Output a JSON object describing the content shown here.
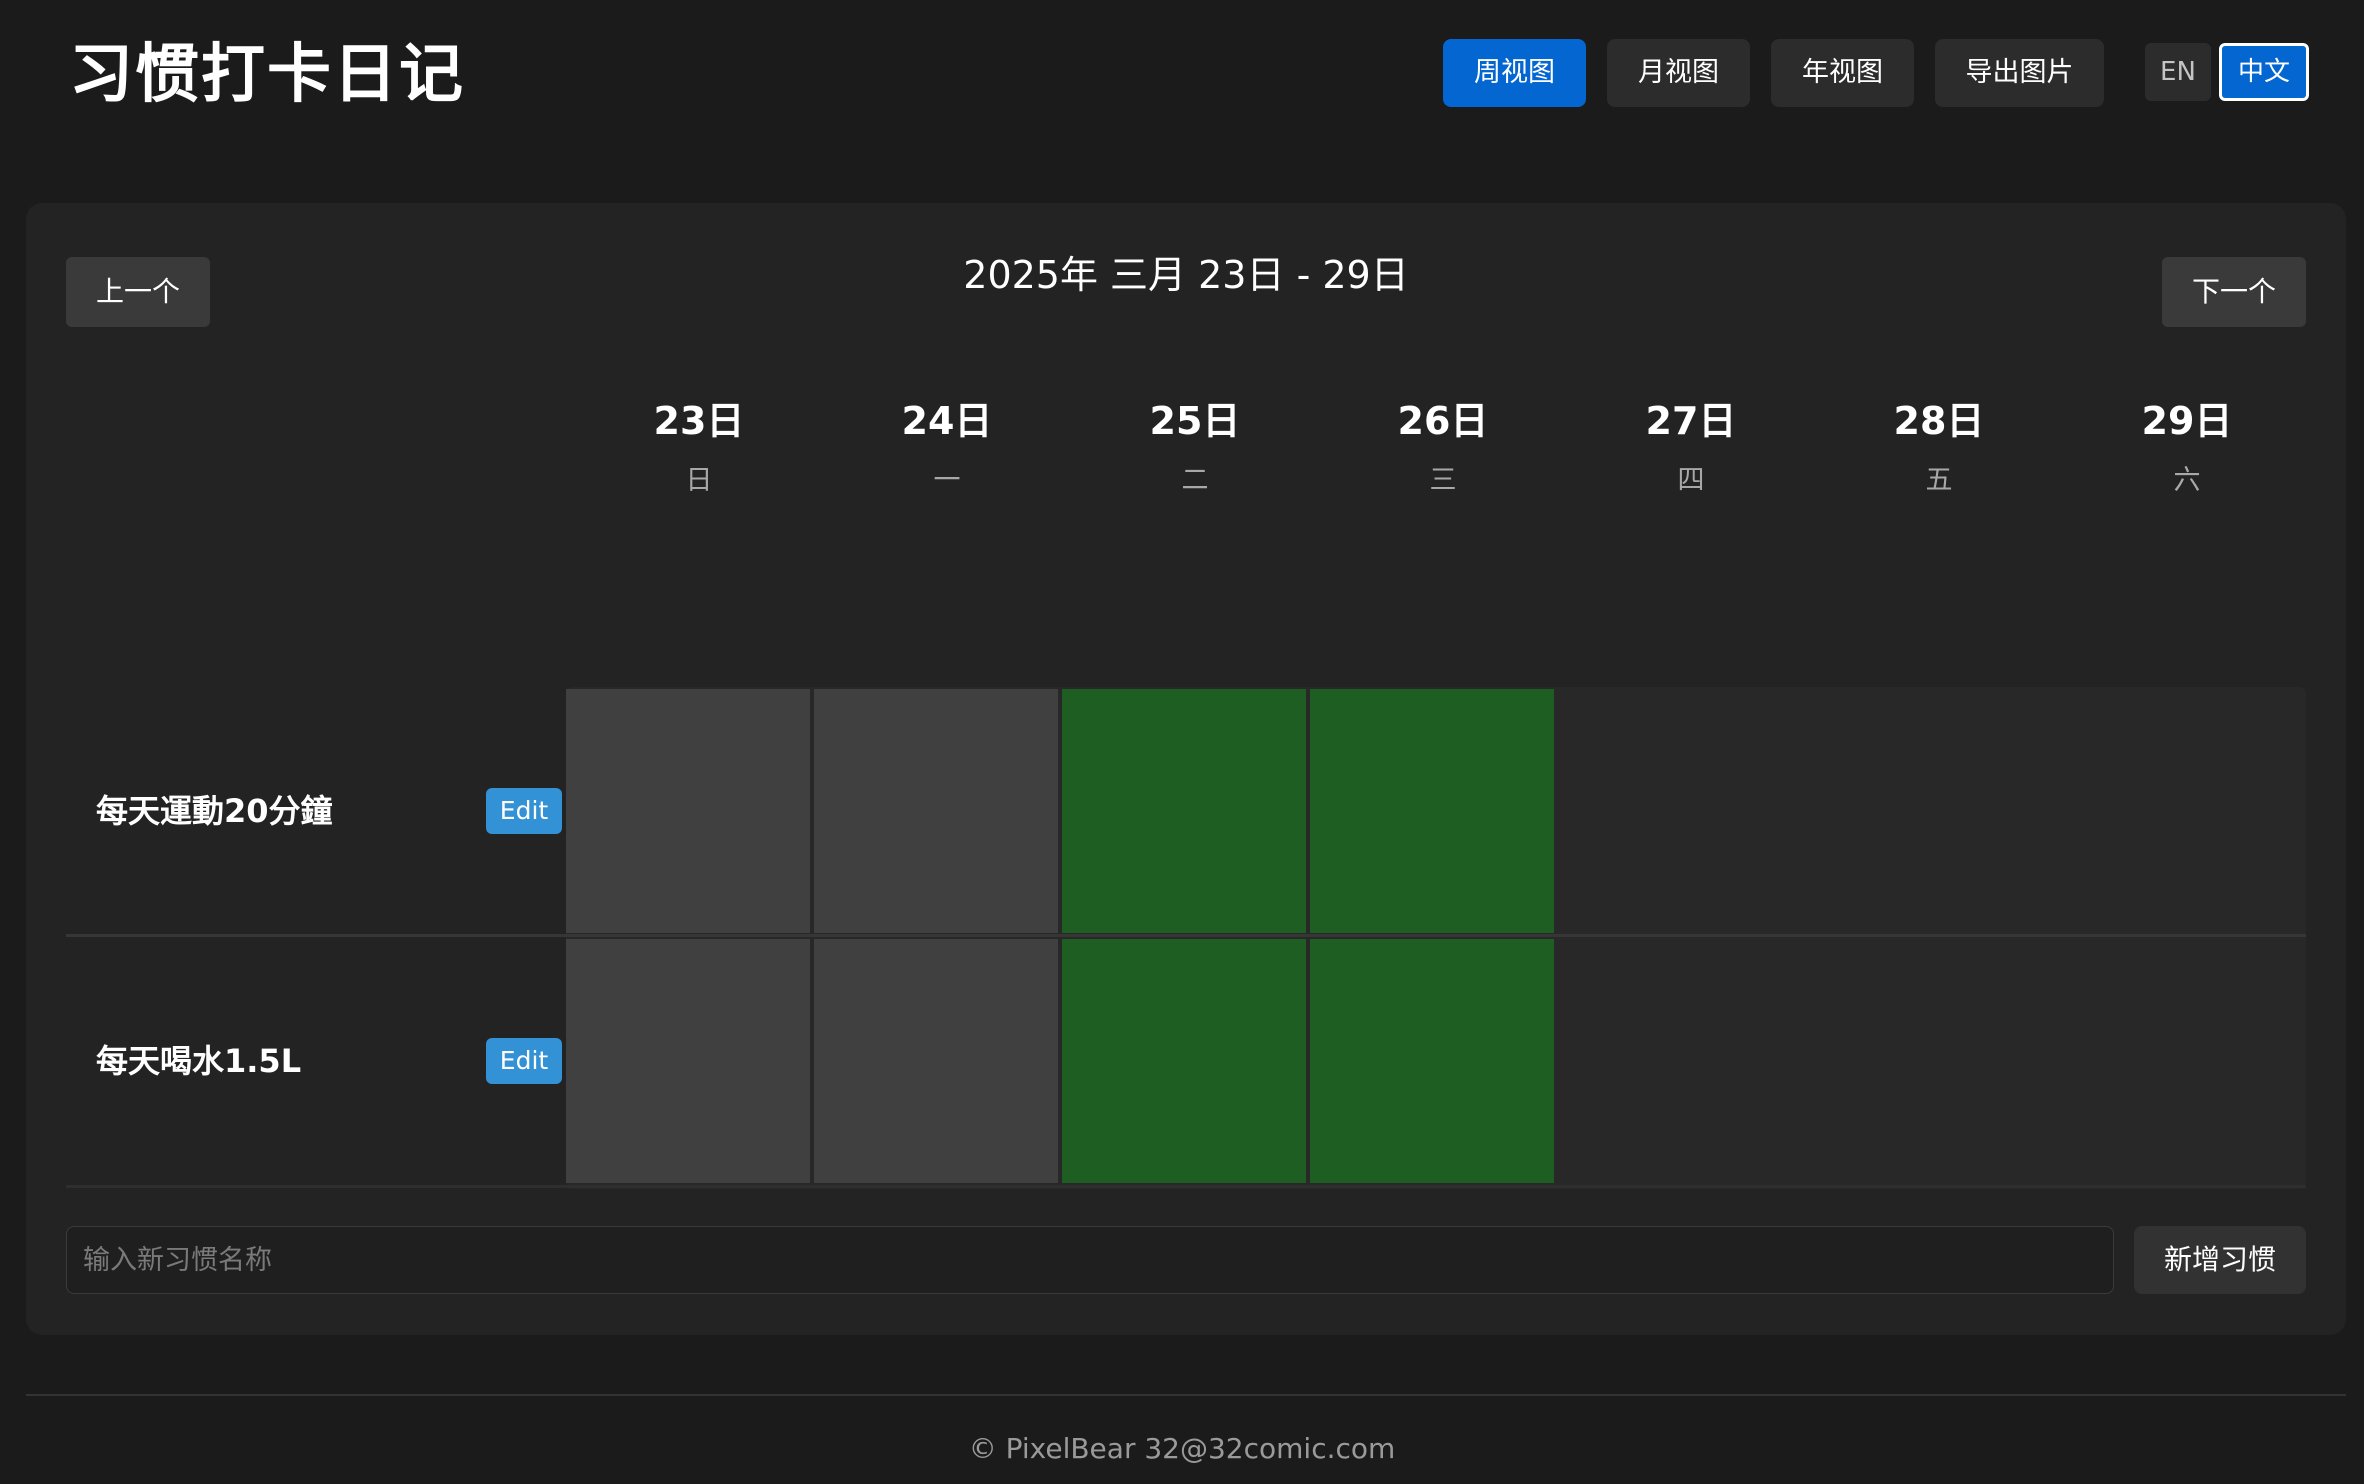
{
  "app": {
    "title": "习惯打卡日记"
  },
  "header": {
    "views": [
      {
        "label": "周视图",
        "active": true
      },
      {
        "label": "月视图",
        "active": false
      },
      {
        "label": "年视图",
        "active": false
      }
    ],
    "export_label": "导出图片",
    "languages": [
      {
        "label": "EN",
        "active": false
      },
      {
        "label": "中文",
        "active": true
      }
    ]
  },
  "week": {
    "prev_label": "上一个",
    "next_label": "下一个",
    "range": "2025年 三月 23日 - 29日",
    "days": [
      {
        "num": "23日",
        "weekday": "日"
      },
      {
        "num": "24日",
        "weekday": "一"
      },
      {
        "num": "25日",
        "weekday": "二"
      },
      {
        "num": "26日",
        "weekday": "三"
      },
      {
        "num": "27日",
        "weekday": "四"
      },
      {
        "num": "28日",
        "weekday": "五"
      },
      {
        "num": "29日",
        "weekday": "六"
      }
    ]
  },
  "habits": [
    {
      "name": "每天運動20分鐘",
      "edit_label": "Edit",
      "days": [
        "missed",
        "missed",
        "done",
        "done",
        "future",
        "future",
        "future"
      ]
    },
    {
      "name": "每天喝水1.5L",
      "edit_label": "Edit",
      "days": [
        "missed",
        "missed",
        "done",
        "done",
        "future",
        "future",
        "future"
      ]
    }
  ],
  "add_habit": {
    "placeholder": "输入新习惯名称",
    "button_label": "新增习惯"
  },
  "footer": {
    "text": "© PixelBear 32@32comic.com"
  },
  "colors": {
    "accent": "#0466d1",
    "done": "#1e5e22",
    "missed": "#404040",
    "edit": "#3391d6",
    "background": "#1b1b1b",
    "card": "#232323"
  }
}
